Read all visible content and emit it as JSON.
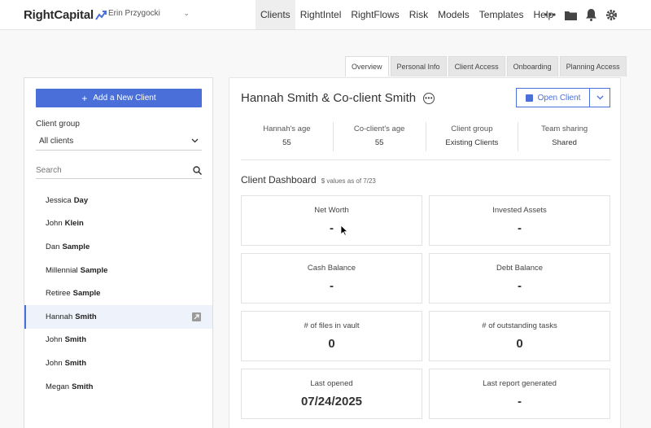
{
  "app": {
    "logo": "RightCapital",
    "user": "Erin Przygocki",
    "nav": [
      "Clients",
      "RightIntel",
      "RightFlows",
      "Risk",
      "Models",
      "Templates",
      "Help"
    ],
    "active_nav": "Clients"
  },
  "tabs": [
    "Overview",
    "Personal Info",
    "Client Access",
    "Onboarding",
    "Planning Access"
  ],
  "sidebar": {
    "add_button": "Add a New Client",
    "client_group_label": "Client group",
    "client_group_value": "All clients",
    "search_placeholder": "Search",
    "clients": [
      {
        "first": "Jessica",
        "last": "Day"
      },
      {
        "first": "John",
        "last": "Klein"
      },
      {
        "first": "Dan",
        "last": "Sample"
      },
      {
        "first": "Millennial",
        "last": "Sample"
      },
      {
        "first": "Retiree",
        "last": "Sample"
      },
      {
        "first": "Hannah",
        "last": "Smith"
      },
      {
        "first": "John",
        "last": "Smith"
      },
      {
        "first": "John",
        "last": "Smith"
      },
      {
        "first": "Megan",
        "last": "Smith"
      }
    ]
  },
  "client": {
    "name": "Hannah Smith & Co-client Smith",
    "open_button": "Open Client",
    "stats": [
      {
        "label": "Hannah's age",
        "value": "55"
      },
      {
        "label": "Co-client's age",
        "value": "55"
      },
      {
        "label": "Client group",
        "value": "Existing Clients"
      },
      {
        "label": "Team sharing",
        "value": "Shared"
      }
    ]
  },
  "dashboard": {
    "title": "Client Dashboard",
    "note": "$ values as of 7/23",
    "cards": [
      {
        "label": "Net Worth",
        "value": "-"
      },
      {
        "label": "Invested Assets",
        "value": "-"
      },
      {
        "label": "Cash Balance",
        "value": "-"
      },
      {
        "label": "Debt Balance",
        "value": "-"
      },
      {
        "label": "# of files in vault",
        "value": "0"
      },
      {
        "label": "# of outstanding tasks",
        "value": "0"
      },
      {
        "label": "Last opened",
        "value": "07/24/2025"
      },
      {
        "label": "Last report generated",
        "value": "-"
      }
    ]
  },
  "colors": {
    "accent": "#4a6fd8"
  }
}
